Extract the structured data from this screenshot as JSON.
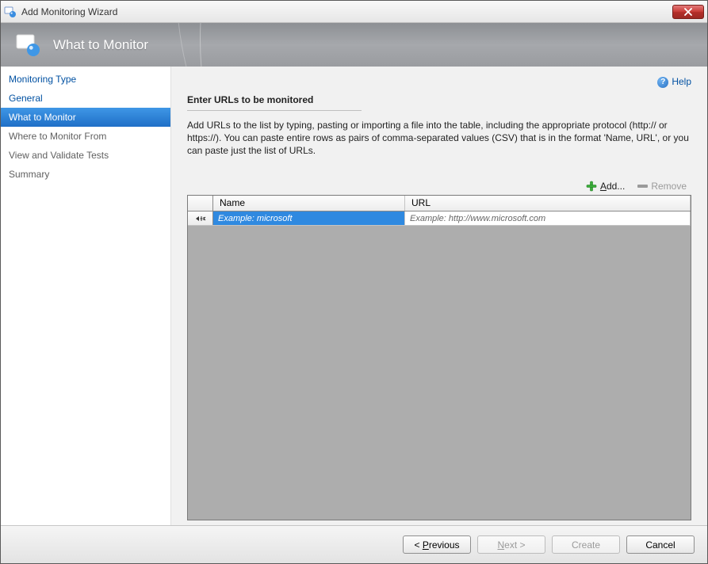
{
  "window": {
    "title": "Add Monitoring Wizard"
  },
  "banner": {
    "title": "What to Monitor"
  },
  "help": {
    "label": "Help"
  },
  "sidebar": {
    "items": [
      {
        "label": "Monitoring Type",
        "state": "link"
      },
      {
        "label": "General",
        "state": "link"
      },
      {
        "label": "What to Monitor",
        "state": "active"
      },
      {
        "label": "Where to Monitor From",
        "state": "muted"
      },
      {
        "label": "View and Validate Tests",
        "state": "muted"
      },
      {
        "label": "Summary",
        "state": "muted"
      }
    ]
  },
  "content": {
    "heading": "Enter URLs to be monitored",
    "instructions": "Add URLs to the list by typing, pasting or importing a file into the table, including the appropriate protocol (http:// or https://). You can paste entire rows as pairs of comma-separated values (CSV) that is in the format 'Name, URL', or you can paste just the list of URLs.",
    "toolbar": {
      "add_label": "Add...",
      "remove_label": "Remove"
    },
    "grid": {
      "columns": {
        "name": "Name",
        "url": "URL"
      },
      "new_row": {
        "name_placeholder": "Example: microsoft",
        "url_placeholder": "Example: http://www.microsoft.com"
      }
    }
  },
  "footer": {
    "previous": "Previous",
    "next": "Next >",
    "create": "Create",
    "cancel": "Cancel"
  }
}
